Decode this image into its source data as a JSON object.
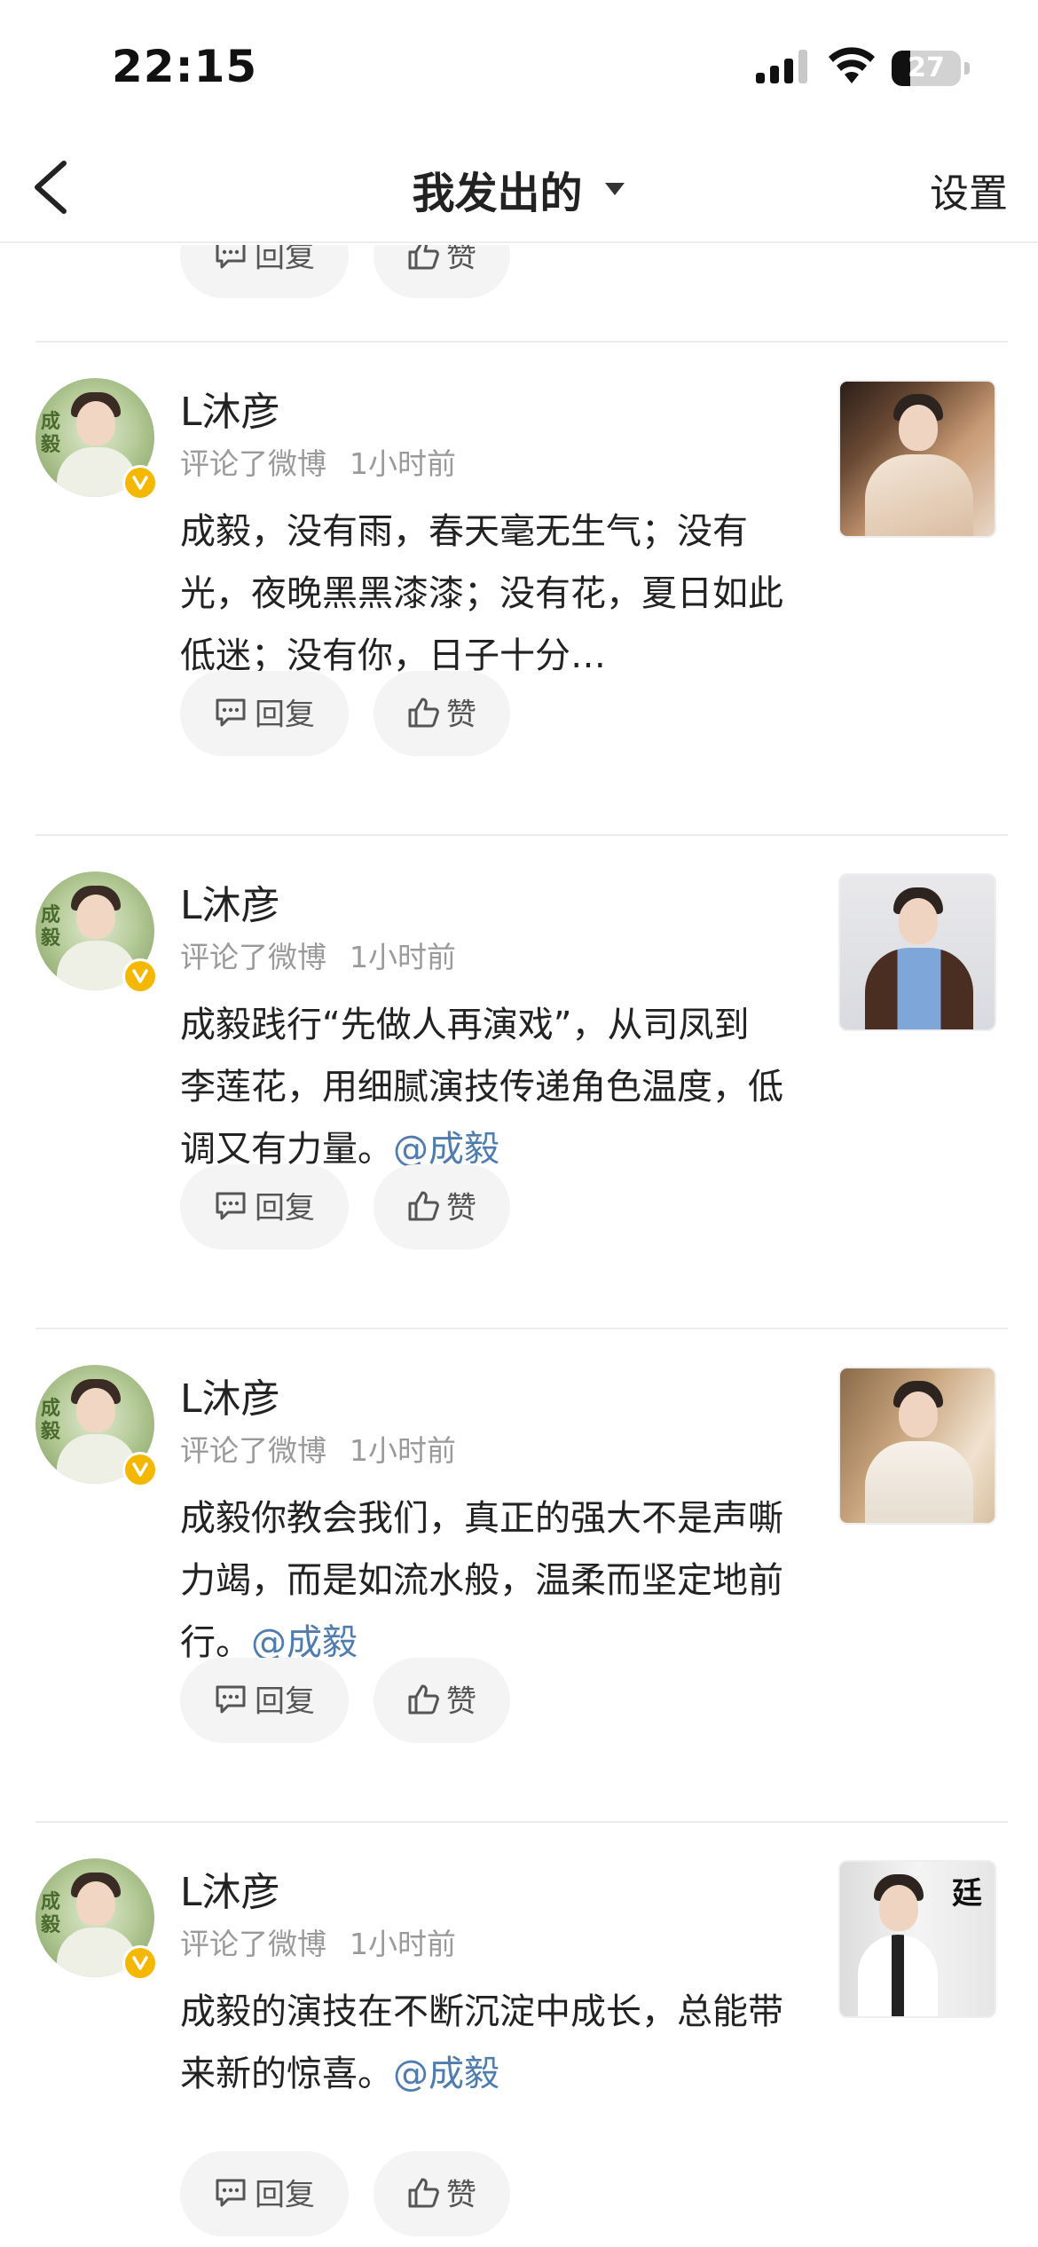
{
  "status_bar": {
    "time": "22:15",
    "battery_level": "27"
  },
  "nav": {
    "title": "我发出的",
    "settings_label": "设置"
  },
  "actions": {
    "reply_label": "回复",
    "like_label": "赞"
  },
  "items": [
    {
      "username": "L沐彦",
      "action": "评论了微博",
      "time": "1小时前",
      "text": "成毅，没有雨，春天毫无生气；没有光，夜晚黑黑漆漆；没有花，夏日如此低迷；没有你，日子十分…",
      "mention": ""
    },
    {
      "username": "L沐彦",
      "action": "评论了微博",
      "time": "1小时前",
      "text": "成毅践行“先做人再演戏”，从司凤到李莲花，用细腻演技传递角色温度，低调又有力量。",
      "mention": "@成毅"
    },
    {
      "username": "L沐彦",
      "action": "评论了微博",
      "time": "1小时前",
      "text": "成毅你教会我们，真正的强大不是声嘶力竭，而是如流水般，温柔而坚定地前行。",
      "mention": "@成毅"
    },
    {
      "username": "L沐彦",
      "action": "评论了微博",
      "time": "1小时前",
      "text": "成毅的演技在不断沉淀中成长，总能带来新的惊喜。",
      "mention": "@成毅"
    }
  ],
  "avatar_seal_text": "成毅",
  "thumb_4_text": "廷",
  "colors": {
    "mention": "#507daf",
    "verified": "#f5b800",
    "pill_bg": "#f4f4f4"
  }
}
